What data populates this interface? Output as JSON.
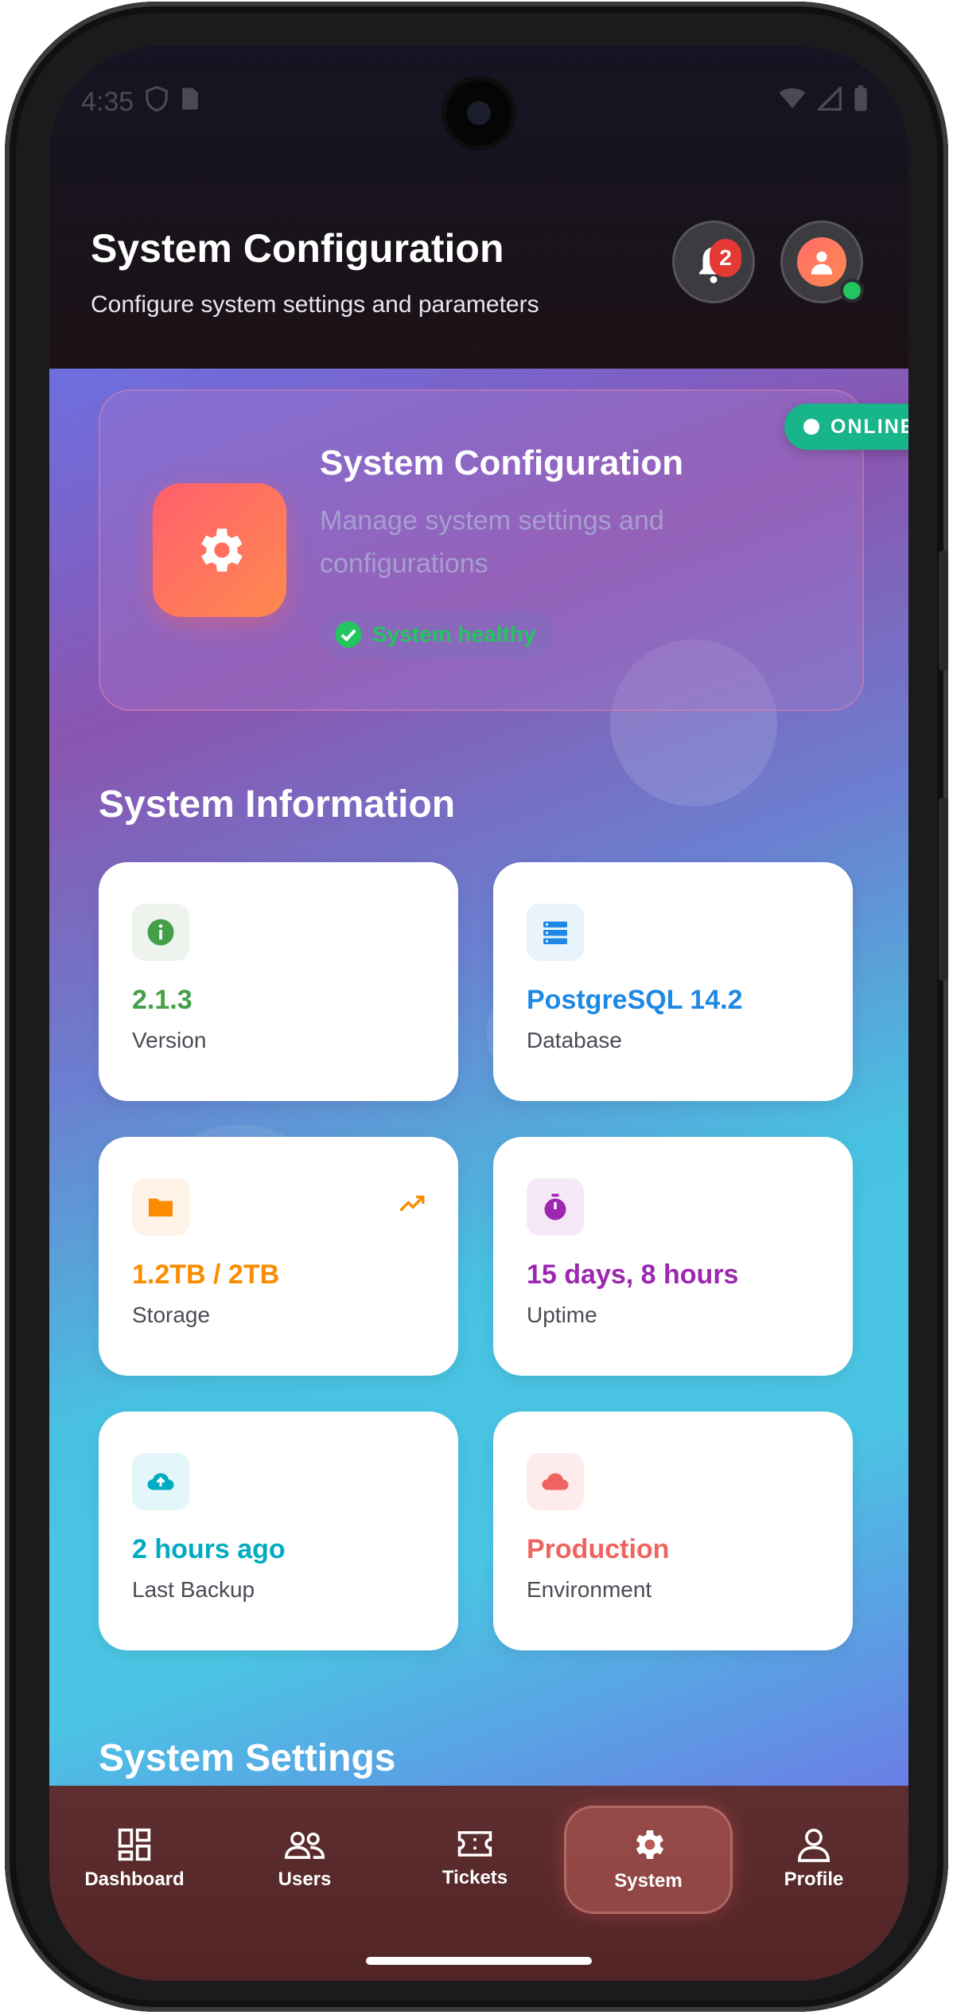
{
  "status_bar": {
    "time": "4:35"
  },
  "header": {
    "title": "System Configuration",
    "subtitle": "Configure system settings and parameters",
    "notification_count": "2"
  },
  "hero": {
    "title": "System Configuration",
    "description": "Manage system settings and configurations",
    "health_text": "System healthy",
    "status_text": "ONLINE"
  },
  "section_info": {
    "title": "System Information"
  },
  "info_cards": [
    {
      "value": "2.1.3",
      "label": "Version",
      "icon": "info-icon",
      "color": "#43a047"
    },
    {
      "value": "PostgreSQL 14.2",
      "label": "Database",
      "icon": "storage-icon",
      "color": "#1e88e5"
    },
    {
      "value": "1.2TB / 2TB",
      "label": "Storage",
      "icon": "folder-icon",
      "color": "#fb8c00"
    },
    {
      "value": "15 days, 8 hours",
      "label": "Uptime",
      "icon": "timer-icon",
      "color": "#9c27b0"
    },
    {
      "value": "2 hours ago",
      "label": "Last Backup",
      "icon": "cloud-upload-icon",
      "color": "#00acc1"
    },
    {
      "value": "Production",
      "label": "Environment",
      "icon": "cloud-icon",
      "color": "#ef6461"
    }
  ],
  "section_settings": {
    "title": "System Settings"
  },
  "nav": [
    {
      "label": "Dashboard",
      "icon": "dashboard-icon"
    },
    {
      "label": "Users",
      "icon": "users-icon"
    },
    {
      "label": "Tickets",
      "icon": "ticket-icon"
    },
    {
      "label": "System",
      "icon": "gear-icon",
      "active": true
    },
    {
      "label": "Profile",
      "icon": "profile-icon"
    }
  ]
}
